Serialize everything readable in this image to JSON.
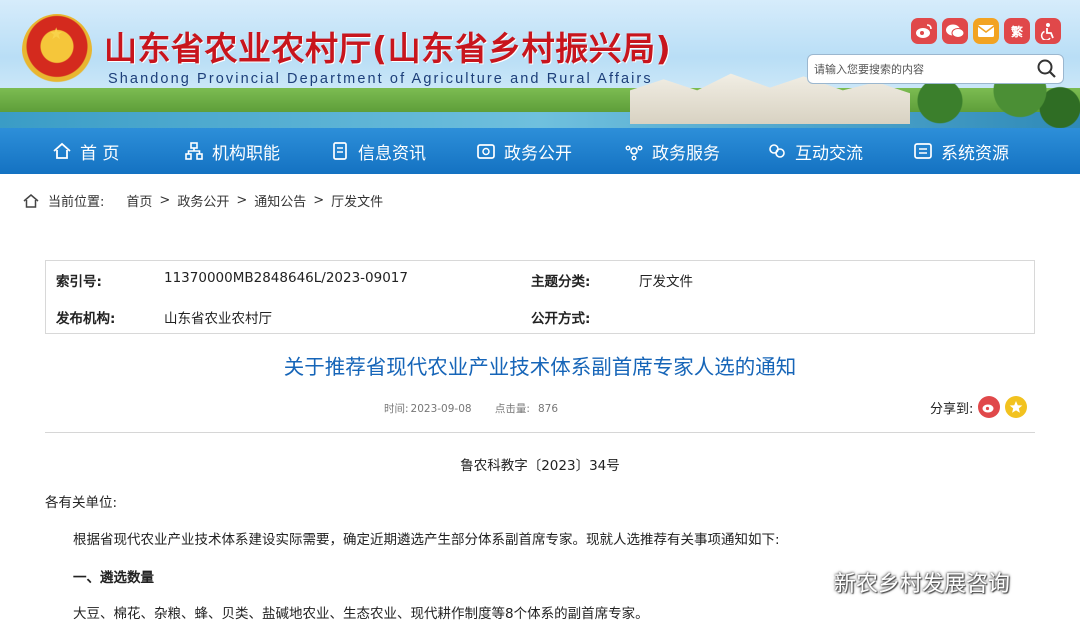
{
  "header": {
    "title": "山东省农业农村厅(山东省乡村振兴局)",
    "subtitle": "Shandong Provincial Department of Agriculture and Rural Affairs",
    "social": [
      {
        "icon": "weibo-icon",
        "label": ""
      },
      {
        "icon": "wechat-icon",
        "label": ""
      },
      {
        "icon": "mail-icon",
        "label": ""
      },
      {
        "icon": "traditional-chinese-icon",
        "label": "繁"
      },
      {
        "icon": "accessibility-icon",
        "label": ""
      }
    ],
    "search_placeholder": "请输入您要搜索的内容"
  },
  "nav": {
    "items": [
      {
        "label": "首 页",
        "icon": "home-icon"
      },
      {
        "label": "机构职能",
        "icon": "org-icon"
      },
      {
        "label": "信息资讯",
        "icon": "document-icon"
      },
      {
        "label": "政务公开",
        "icon": "gov-icon"
      },
      {
        "label": "政务服务",
        "icon": "service-icon"
      },
      {
        "label": "互动交流",
        "icon": "chat-icon"
      },
      {
        "label": "系统资源",
        "icon": "resources-icon"
      }
    ]
  },
  "breadcrumb": {
    "label": "当前位置:",
    "items": [
      "首页",
      "政务公开",
      "通知公告",
      "厅发文件"
    ],
    "separator": ">"
  },
  "info": {
    "index_key": "索引号:",
    "index_value": "11370000MB2848646L/2023-09017",
    "topic_key": "主题分类:",
    "topic_value": "厅发文件",
    "issuer_key": "发布机构:",
    "issuer_value": "山东省农业农村厅",
    "open_key": "公开方式:",
    "open_value": ""
  },
  "article": {
    "title": "关于推荐省现代农业产业技术体系副首席专家人选的通知",
    "time_label": "时间:",
    "time_value": "2023-09-08",
    "clicks_label": "点击量:",
    "clicks_value": "876",
    "share_label": "分享到:",
    "doc_number": "鲁农科教字〔2023〕34号",
    "salutation": "各有关单位:",
    "paragraph1": "根据省现代农业产业技术体系建设实际需要，确定近期遴选产生部分体系副首席专家。现就人选推荐有关事项通知如下:",
    "section1_heading": "一、遴选数量",
    "section1_text": "大豆、棉花、杂粮、蜂、贝类、盐碱地农业、生态农业、现代耕作制度等8个体系的副首席专家。"
  },
  "watermark": {
    "text": "新农乡村发展咨询"
  },
  "colors": {
    "nav_bg": "#1a7bcc",
    "title_red": "#c8151d",
    "article_title_blue": "#1665b8"
  }
}
